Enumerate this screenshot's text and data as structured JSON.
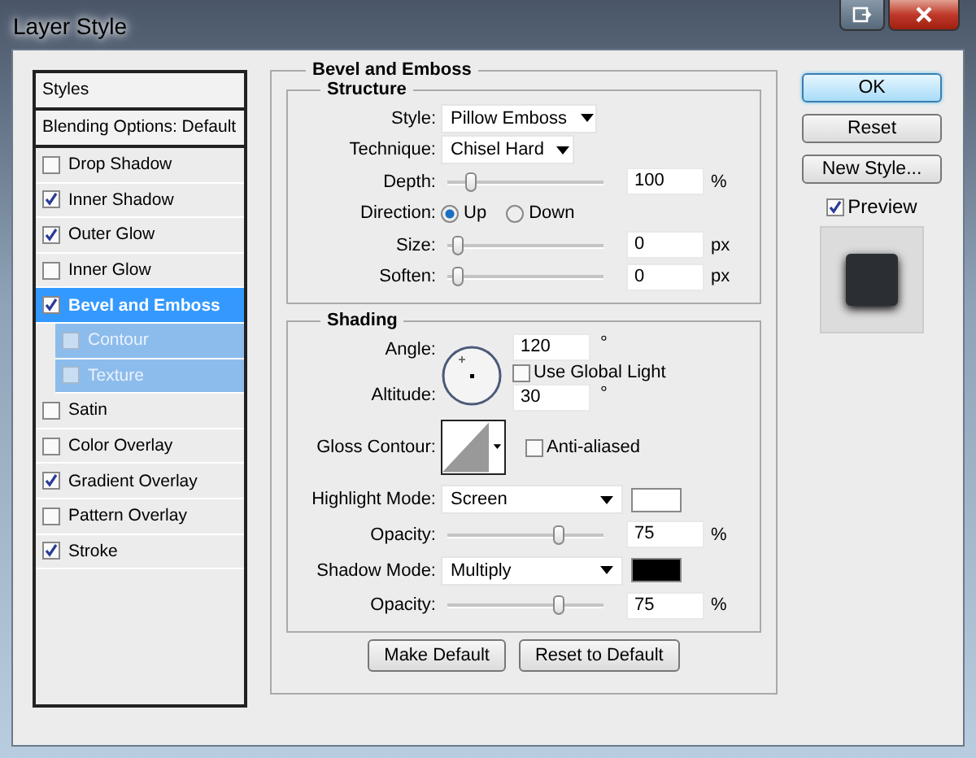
{
  "window": {
    "title": "Layer Style"
  },
  "styles_panel": {
    "header": "Styles",
    "blending": "Blending Options: Default",
    "items": [
      {
        "label": "Drop Shadow",
        "checked": false,
        "selected": false
      },
      {
        "label": "Inner Shadow",
        "checked": true,
        "selected": false
      },
      {
        "label": "Outer Glow",
        "checked": true,
        "selected": false
      },
      {
        "label": "Inner Glow",
        "checked": false,
        "selected": false
      },
      {
        "label": "Bevel and Emboss",
        "checked": true,
        "selected": true,
        "children": [
          {
            "label": "Contour",
            "checked": false
          },
          {
            "label": "Texture",
            "checked": false
          }
        ]
      },
      {
        "label": "Satin",
        "checked": false,
        "selected": false
      },
      {
        "label": "Color Overlay",
        "checked": false,
        "selected": false
      },
      {
        "label": "Gradient Overlay",
        "checked": true,
        "selected": false
      },
      {
        "label": "Pattern Overlay",
        "checked": false,
        "selected": false
      },
      {
        "label": "Stroke",
        "checked": true,
        "selected": false
      }
    ]
  },
  "bevel": {
    "title": "Bevel and Emboss",
    "structure": {
      "title": "Structure",
      "style": {
        "label": "Style:",
        "value": "Pillow Emboss"
      },
      "technique": {
        "label": "Technique:",
        "value": "Chisel Hard"
      },
      "depth": {
        "label": "Depth:",
        "level": 0.1,
        "value": "100",
        "unit": "%"
      },
      "direction": {
        "label": "Direction:",
        "options": [
          {
            "label": "Up",
            "selected": true
          },
          {
            "label": "Down",
            "selected": false
          }
        ]
      },
      "size": {
        "label": "Size:",
        "level": 0,
        "value": "0",
        "unit": "px"
      },
      "soften": {
        "label": "Soften:",
        "level": 0,
        "value": "0",
        "unit": "px"
      }
    },
    "shading": {
      "title": "Shading",
      "angle": {
        "label": "Angle:",
        "value": "120",
        "unit": "°"
      },
      "global_light": {
        "label": "Use Global Light",
        "checked": false
      },
      "altitude": {
        "label": "Altitude:",
        "value": "30",
        "unit": "°"
      },
      "gloss_contour": {
        "label": "Gloss Contour:"
      },
      "anti_aliased": {
        "label": "Anti-aliased",
        "checked": false
      },
      "highlight_mode": {
        "label": "Highlight Mode:",
        "value": "Screen",
        "color": "#ffffff"
      },
      "highlight_opacity": {
        "label": "Opacity:",
        "level": 0.75,
        "value": "75",
        "unit": "%"
      },
      "shadow_mode": {
        "label": "Shadow Mode:",
        "value": "Multiply",
        "color": "#000000"
      },
      "shadow_opacity": {
        "label": "Opacity:",
        "level": 0.75,
        "value": "75",
        "unit": "%"
      }
    },
    "buttons": [
      "Make Default",
      "Reset to Default"
    ]
  },
  "side": {
    "buttons": [
      {
        "label": "OK",
        "kind": "default"
      },
      {
        "label": "Reset",
        "kind": "normal"
      },
      {
        "label": "New Style...",
        "kind": "normal"
      }
    ],
    "preview": {
      "label": "Preview",
      "checked": true
    }
  }
}
